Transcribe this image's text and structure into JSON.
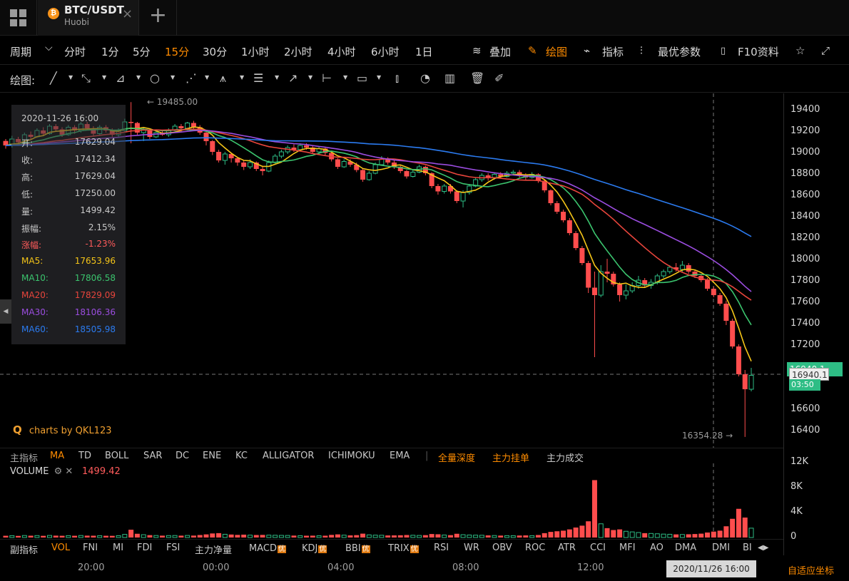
{
  "tab": {
    "coin_glyph": "₿",
    "pair": "BTC/USDT",
    "exchange": "Huobi",
    "close": "×",
    "add": "+"
  },
  "toolbar": {
    "period_label": "周期",
    "period_caret": "⌵",
    "intervals": [
      "分时",
      "1分",
      "5分",
      "15分",
      "30分",
      "1小时",
      "2小时",
      "4小时",
      "6小时",
      "1日"
    ],
    "active_interval": "15分",
    "overlay": "叠加",
    "draw": "绘图",
    "indicators": "指标",
    "best_params": "最优参数",
    "f10": "F10资料"
  },
  "draw_toolbar": {
    "label": "绘图:"
  },
  "info_panel": {
    "time": "2020-11-26 16:00",
    "rows": [
      {
        "key": "开:",
        "value": "17629.04",
        "color": "#c8c8c8"
      },
      {
        "key": "收:",
        "value": "17412.34",
        "color": "#c8c8c8"
      },
      {
        "key": "高:",
        "value": "17629.04",
        "color": "#c8c8c8"
      },
      {
        "key": "低:",
        "value": "17250.00",
        "color": "#c8c8c8"
      },
      {
        "key": "量:",
        "value": "1499.42",
        "color": "#c8c8c8"
      },
      {
        "key": "振幅:",
        "value": "2.15%",
        "color": "#c8c8c8"
      },
      {
        "key": "涨幅:",
        "value": "-1.23%",
        "color": "#ff5b5b"
      },
      {
        "key": "MA5:",
        "value": "17653.96",
        "color": "#f5c518"
      },
      {
        "key": "MA10:",
        "value": "17806.58",
        "color": "#3bc46e"
      },
      {
        "key": "MA20:",
        "value": "17829.09",
        "color": "#e8453c"
      },
      {
        "key": "MA30:",
        "value": "18106.36",
        "color": "#9b4de0"
      },
      {
        "key": "MA60:",
        "value": "18505.98",
        "color": "#2b7bf0"
      }
    ]
  },
  "branding": "charts by QKL123",
  "main_indicators": {
    "label": "主指标",
    "items": [
      "MA",
      "TD",
      "BOLL",
      "SAR",
      "DC",
      "ENE",
      "KC",
      "ALLIGATOR",
      "ICHIMOKU",
      "EMA"
    ],
    "active": "MA",
    "extra": [
      "全量深度",
      "主力挂单",
      "主力成交"
    ]
  },
  "volume": {
    "label": "VOLUME",
    "value": "1499.42"
  },
  "sub_indicators": {
    "label": "副指标",
    "items": [
      "VOL",
      "FNI",
      "MI",
      "FDI",
      "FSI",
      "主力净量",
      "MACD",
      "KDJ",
      "BBI",
      "TRIX",
      "RSI",
      "WR",
      "OBV",
      "ROC",
      "ATR",
      "CCI",
      "MFI",
      "AO",
      "DMA",
      "DMI",
      "BI"
    ],
    "badged": [
      "MACD",
      "KDJ",
      "BBI",
      "TRIX"
    ],
    "badge_text": "优",
    "active": "VOL"
  },
  "time_axis": {
    "labels": [
      "20:00",
      "00:00",
      "04:00",
      "08:00",
      "12:00"
    ],
    "crosshair_date": "2020/11/26 16:00",
    "autofit": "自适应坐标"
  },
  "price_axis": {
    "labels": [
      "19400",
      "19200",
      "19000",
      "18800",
      "18600",
      "18400",
      "18200",
      "18000",
      "17800",
      "17600",
      "17400",
      "17200",
      "16600",
      "16400"
    ],
    "current_price": "16940.1",
    "current_tag": "16940.1",
    "countdown": "03:50",
    "high_marker": "← 19485.00",
    "low_marker": "16354.28 →"
  },
  "volume_axis": {
    "labels": [
      "12K",
      "8K",
      "4K",
      "0"
    ]
  },
  "chart_data": {
    "type": "candlestick",
    "interval": "15分",
    "price_range": [
      16300,
      19500
    ],
    "volume_range": [
      0,
      12000
    ],
    "candles": [
      [
        19122,
        19080,
        19140,
        19050,
        280
      ],
      [
        19080,
        19140,
        19170,
        19060,
        300
      ],
      [
        19140,
        19110,
        19160,
        19090,
        260
      ],
      [
        19110,
        19180,
        19200,
        19100,
        320
      ],
      [
        19180,
        19160,
        19210,
        19140,
        290
      ],
      [
        19160,
        19220,
        19240,
        19150,
        310
      ],
      [
        19220,
        19190,
        19250,
        19170,
        270
      ],
      [
        19190,
        19260,
        19280,
        19180,
        330
      ],
      [
        19260,
        19230,
        19280,
        19210,
        300
      ],
      [
        19230,
        19180,
        19250,
        19160,
        280
      ],
      [
        19180,
        19250,
        19270,
        19170,
        300
      ],
      [
        19250,
        19220,
        19270,
        19190,
        280
      ],
      [
        19220,
        19280,
        19300,
        19200,
        320
      ],
      [
        19280,
        19240,
        19300,
        19220,
        300
      ],
      [
        19240,
        19190,
        19260,
        19170,
        290
      ],
      [
        19190,
        19250,
        19270,
        19180,
        300
      ],
      [
        19250,
        19220,
        19270,
        19200,
        280
      ],
      [
        19220,
        19180,
        19240,
        19160,
        270
      ],
      [
        19180,
        19220,
        19240,
        19160,
        290
      ],
      [
        19220,
        19300,
        19330,
        19200,
        500
      ],
      [
        19300,
        19290,
        19485,
        19100,
        1250
      ],
      [
        19290,
        19200,
        19300,
        19180,
        600
      ],
      [
        19200,
        19230,
        19250,
        19120,
        450
      ],
      [
        19230,
        19160,
        19240,
        19140,
        380
      ],
      [
        19160,
        19200,
        19220,
        19150,
        320
      ],
      [
        19200,
        19180,
        19220,
        19170,
        300
      ],
      [
        19180,
        19220,
        19240,
        19160,
        310
      ],
      [
        19220,
        19260,
        19280,
        19210,
        320
      ],
      [
        19260,
        19240,
        19280,
        19210,
        300
      ],
      [
        19240,
        19290,
        19300,
        19220,
        330
      ],
      [
        19290,
        19250,
        19310,
        19230,
        310
      ],
      [
        19250,
        19200,
        19270,
        19180,
        400
      ],
      [
        19200,
        19120,
        19220,
        19080,
        500
      ],
      [
        19120,
        19020,
        19130,
        18990,
        650
      ],
      [
        19020,
        18940,
        19040,
        18920,
        700
      ],
      [
        18940,
        19000,
        19020,
        18900,
        520
      ],
      [
        19000,
        18960,
        19010,
        18920,
        480
      ],
      [
        18960,
        18920,
        18970,
        18890,
        420
      ],
      [
        18920,
        18880,
        18940,
        18850,
        460
      ],
      [
        18880,
        18920,
        18950,
        18860,
        380
      ],
      [
        18920,
        18860,
        18930,
        18840,
        400
      ],
      [
        18860,
        18840,
        18880,
        18800,
        420
      ],
      [
        18840,
        18920,
        18940,
        18830,
        380
      ],
      [
        18920,
        18980,
        19000,
        18910,
        360
      ],
      [
        18980,
        19020,
        19040,
        18960,
        340
      ],
      [
        19020,
        19060,
        19080,
        19000,
        330
      ],
      [
        19060,
        19040,
        19090,
        19020,
        310
      ],
      [
        19040,
        19080,
        19100,
        19030,
        300
      ],
      [
        19080,
        19060,
        19100,
        19040,
        290
      ],
      [
        19060,
        19020,
        19080,
        19000,
        300
      ],
      [
        19020,
        19050,
        19070,
        19000,
        280
      ],
      [
        19050,
        19010,
        19060,
        18990,
        290
      ],
      [
        19010,
        18950,
        19020,
        18930,
        420
      ],
      [
        18950,
        18880,
        18960,
        18860,
        500
      ],
      [
        18880,
        18930,
        18950,
        18870,
        380
      ],
      [
        18930,
        18900,
        18950,
        18880,
        340
      ],
      [
        18900,
        18850,
        18920,
        18830,
        380
      ],
      [
        18850,
        18760,
        18860,
        18740,
        620
      ],
      [
        18760,
        18820,
        18840,
        18750,
        420
      ],
      [
        18820,
        18900,
        18920,
        18810,
        380
      ],
      [
        18900,
        18950,
        18980,
        18890,
        360
      ],
      [
        18950,
        18920,
        18970,
        18900,
        330
      ],
      [
        18920,
        18880,
        18940,
        18860,
        340
      ],
      [
        18880,
        18840,
        18900,
        18820,
        360
      ],
      [
        18840,
        18790,
        18850,
        18770,
        400
      ],
      [
        18790,
        18830,
        18850,
        18780,
        360
      ],
      [
        18830,
        18880,
        18900,
        18820,
        330
      ],
      [
        18880,
        18820,
        18890,
        18800,
        380
      ],
      [
        18820,
        18700,
        18830,
        18680,
        560
      ],
      [
        18700,
        18650,
        18720,
        18620,
        520
      ],
      [
        18650,
        18700,
        18720,
        18630,
        400
      ],
      [
        18700,
        18650,
        18720,
        18630,
        380
      ],
      [
        18650,
        18560,
        18660,
        18540,
        600
      ],
      [
        18560,
        18640,
        18660,
        18500,
        450
      ],
      [
        18640,
        18700,
        18720,
        18620,
        400
      ],
      [
        18700,
        18760,
        18780,
        18690,
        380
      ],
      [
        18760,
        18800,
        18820,
        18740,
        360
      ],
      [
        18800,
        18780,
        18820,
        18750,
        340
      ],
      [
        18780,
        18810,
        18830,
        18760,
        320
      ],
      [
        18810,
        18790,
        18830,
        18770,
        310
      ],
      [
        18790,
        18820,
        18840,
        18780,
        300
      ],
      [
        18820,
        18830,
        18850,
        18800,
        300
      ],
      [
        18830,
        18800,
        18850,
        18780,
        320
      ],
      [
        18800,
        18780,
        18820,
        18760,
        340
      ],
      [
        18780,
        18810,
        18830,
        18770,
        300
      ],
      [
        18810,
        18750,
        18820,
        18730,
        400
      ],
      [
        18750,
        18660,
        18760,
        18640,
        700
      ],
      [
        18660,
        18540,
        18670,
        18520,
        900
      ],
      [
        18540,
        18460,
        18560,
        18440,
        1000
      ],
      [
        18460,
        18380,
        18480,
        18360,
        1100
      ],
      [
        18380,
        18260,
        18400,
        18240,
        1300
      ],
      [
        18260,
        18120,
        18280,
        18100,
        1600
      ],
      [
        18120,
        17980,
        18140,
        17960,
        1900
      ],
      [
        17980,
        17750,
        18000,
        17700,
        2600
      ],
      [
        17750,
        17680,
        17900,
        17100,
        9200
      ],
      [
        17680,
        17900,
        17960,
        17660,
        2200
      ],
      [
        17900,
        17880,
        18020,
        17800,
        1500
      ],
      [
        17880,
        17780,
        17900,
        17760,
        1200
      ],
      [
        17780,
        17680,
        17800,
        17620,
        1300
      ],
      [
        17680,
        17720,
        17780,
        17640,
        1000
      ],
      [
        17720,
        17770,
        17800,
        17700,
        900
      ],
      [
        17770,
        17820,
        17860,
        17740,
        800
      ],
      [
        17820,
        17770,
        17840,
        17750,
        700
      ],
      [
        17770,
        17800,
        17830,
        17740,
        650
      ],
      [
        17800,
        17860,
        17880,
        17780,
        600
      ],
      [
        17860,
        17900,
        17920,
        17840,
        550
      ],
      [
        17900,
        17940,
        17960,
        17880,
        520
      ],
      [
        17940,
        17920,
        17980,
        17900,
        500
      ],
      [
        17920,
        17960,
        18000,
        17900,
        480
      ],
      [
        17960,
        17900,
        17980,
        17880,
        520
      ],
      [
        17900,
        17860,
        17920,
        17840,
        560
      ],
      [
        17860,
        17820,
        17880,
        17800,
        620
      ],
      [
        17820,
        17740,
        17840,
        17720,
        800
      ],
      [
        17740,
        17680,
        17760,
        17660,
        950
      ],
      [
        17680,
        17600,
        17700,
        17580,
        1100
      ],
      [
        17600,
        17440,
        17629,
        17400,
        1800
      ],
      [
        17440,
        17200,
        17460,
        17180,
        3000
      ],
      [
        17200,
        16940,
        17220,
        16920,
        4600
      ],
      [
        16940,
        16800,
        16980,
        16354,
        3200
      ],
      [
        16800,
        16930,
        17000,
        16780,
        1499
      ]
    ],
    "ma": [
      {
        "name": "MA5",
        "color": "#f5c518"
      },
      {
        "name": "MA10",
        "color": "#3bc46e"
      },
      {
        "name": "MA20",
        "color": "#e8453c"
      },
      {
        "name": "MA30",
        "color": "#9b4de0"
      },
      {
        "name": "MA60",
        "color": "#2b7bf0"
      }
    ],
    "up_color": "#2ebd85",
    "down_color": "#ff4d4d"
  }
}
